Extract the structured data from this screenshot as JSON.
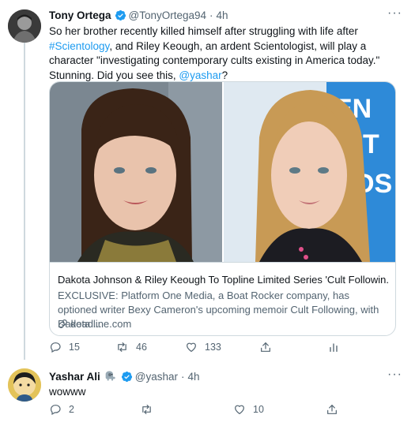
{
  "tweets": [
    {
      "display_name": "Tony Ortega",
      "handle": "@TonyOrtega94",
      "separator": "·",
      "time": "4h",
      "text_parts": {
        "a": "So her brother recently killed himself after struggling with life after ",
        "hashtag": "#Scientology",
        "b": ", and Riley Keough, an ardent Scientologist, will play a character \"investigating contemporary cults existing in America today.\" Stunning. Did you see this, ",
        "mention": "@yashar",
        "c": "?"
      },
      "card": {
        "title": "Dakota Johnson & Riley Keough To Topline Limited Series 'Cult Followin...",
        "description": "EXCLUSIVE: Platform One Media, a Boat Rocker company, has optioned writer Bexy Cameron's upcoming memoir Cult Following, with Dakota ...",
        "domain": "deadline.com"
      },
      "actions": {
        "replies": "15",
        "retweets": "46",
        "likes": "133"
      }
    },
    {
      "display_name": "Yashar Ali",
      "name_emoji": "elephant-emoji",
      "handle": "@yashar",
      "separator": "·",
      "time": "4h",
      "text": "wowww",
      "actions": {
        "replies": "2",
        "retweets": "",
        "likes": "10"
      }
    }
  ],
  "more_label": "···",
  "colors": {
    "accent": "#1d9bf0",
    "text": "#0f1419",
    "muted": "#536471",
    "border": "#cfd9de"
  },
  "icons": [
    "verified-badge-icon",
    "more-icon",
    "reply-icon",
    "retweet-icon",
    "like-icon",
    "share-icon",
    "analytics-icon",
    "link-icon",
    "elephant-emoji"
  ]
}
